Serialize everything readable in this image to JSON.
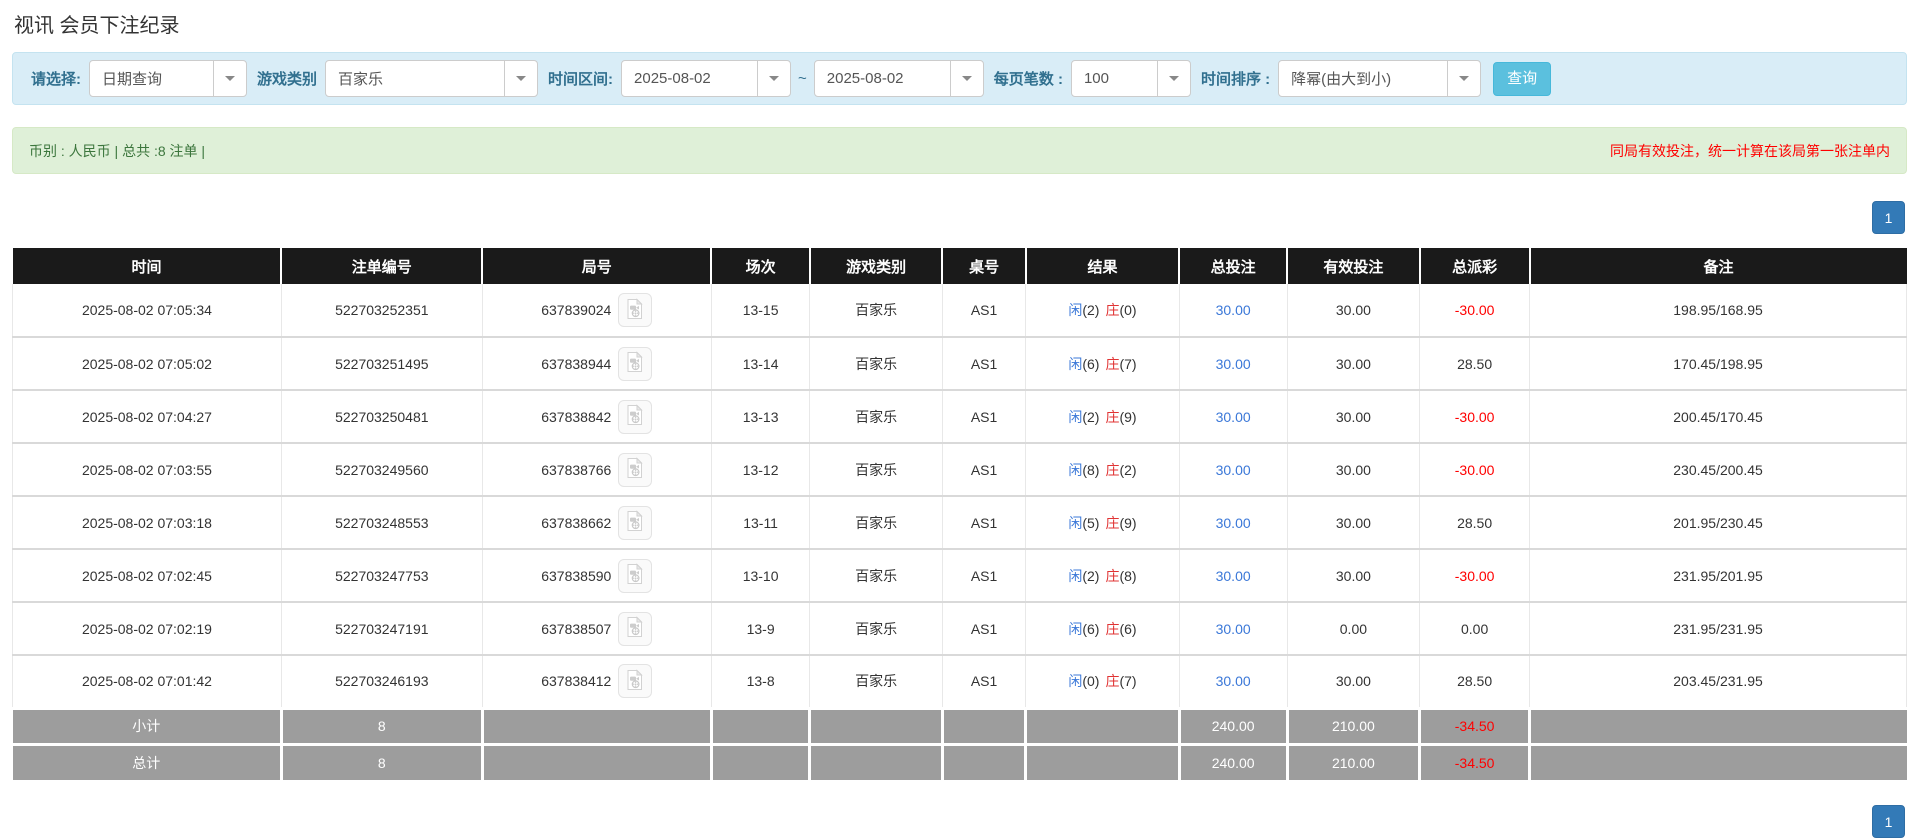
{
  "page": {
    "title": "视讯 会员下注纪录"
  },
  "toolbar": {
    "query_type": {
      "label": "请选择:",
      "value": "日期查询"
    },
    "game_category": {
      "label": "游戏类别",
      "value": "百家乐"
    },
    "time_range": {
      "label": "时间区间:",
      "from": "2025-08-02",
      "separator": "~",
      "to": "2025-08-02"
    },
    "page_size": {
      "label": "每页笔数 :",
      "value": "100"
    },
    "time_sort": {
      "label": "时间排序 :",
      "value": "降幂(由大到小)"
    },
    "search_button": "查询"
  },
  "summary_bar": {
    "left_text": "币别 : 人民币 | 总共 :8 注单 |",
    "right_note": "同局有效投注，统一计算在该局第一张注单内"
  },
  "pagination": {
    "current_page": "1"
  },
  "table": {
    "headers": [
      "时间",
      "注单编号",
      "局号",
      "场次",
      "游戏类别",
      "桌号",
      "结果",
      "总投注",
      "有效投注",
      "总派彩",
      "备注"
    ],
    "rows": [
      {
        "time": "2025-08-02 07:05:34",
        "bet_no": "522703252351",
        "round_no": "637839024",
        "session": "13-15",
        "game": "百家乐",
        "table_no": "AS1",
        "result_p": "闲",
        "result_pv": "(2)",
        "result_b": "庄",
        "result_bv": "(0)",
        "total_bet": "30.00",
        "valid_bet": "30.00",
        "payout": "-30.00",
        "remark": "198.95/168.95"
      },
      {
        "time": "2025-08-02 07:05:02",
        "bet_no": "522703251495",
        "round_no": "637838944",
        "session": "13-14",
        "game": "百家乐",
        "table_no": "AS1",
        "result_p": "闲",
        "result_pv": "(6)",
        "result_b": "庄",
        "result_bv": "(7)",
        "total_bet": "30.00",
        "valid_bet": "30.00",
        "payout": "28.50",
        "remark": "170.45/198.95"
      },
      {
        "time": "2025-08-02 07:04:27",
        "bet_no": "522703250481",
        "round_no": "637838842",
        "session": "13-13",
        "game": "百家乐",
        "table_no": "AS1",
        "result_p": "闲",
        "result_pv": "(2)",
        "result_b": "庄",
        "result_bv": "(9)",
        "total_bet": "30.00",
        "valid_bet": "30.00",
        "payout": "-30.00",
        "remark": "200.45/170.45"
      },
      {
        "time": "2025-08-02 07:03:55",
        "bet_no": "522703249560",
        "round_no": "637838766",
        "session": "13-12",
        "game": "百家乐",
        "table_no": "AS1",
        "result_p": "闲",
        "result_pv": "(8)",
        "result_b": "庄",
        "result_bv": "(2)",
        "total_bet": "30.00",
        "valid_bet": "30.00",
        "payout": "-30.00",
        "remark": "230.45/200.45"
      },
      {
        "time": "2025-08-02 07:03:18",
        "bet_no": "522703248553",
        "round_no": "637838662",
        "session": "13-11",
        "game": "百家乐",
        "table_no": "AS1",
        "result_p": "闲",
        "result_pv": "(5)",
        "result_b": "庄",
        "result_bv": "(9)",
        "total_bet": "30.00",
        "valid_bet": "30.00",
        "payout": "28.50",
        "remark": "201.95/230.45"
      },
      {
        "time": "2025-08-02 07:02:45",
        "bet_no": "522703247753",
        "round_no": "637838590",
        "session": "13-10",
        "game": "百家乐",
        "table_no": "AS1",
        "result_p": "闲",
        "result_pv": "(2)",
        "result_b": "庄",
        "result_bv": "(8)",
        "total_bet": "30.00",
        "valid_bet": "30.00",
        "payout": "-30.00",
        "remark": "231.95/201.95"
      },
      {
        "time": "2025-08-02 07:02:19",
        "bet_no": "522703247191",
        "round_no": "637838507",
        "session": "13-9",
        "game": "百家乐",
        "table_no": "AS1",
        "result_p": "闲",
        "result_pv": "(6)",
        "result_b": "庄",
        "result_bv": "(6)",
        "total_bet": "30.00",
        "valid_bet": "0.00",
        "payout": "0.00",
        "remark": "231.95/231.95"
      },
      {
        "time": "2025-08-02 07:01:42",
        "bet_no": "522703246193",
        "round_no": "637838412",
        "session": "13-8",
        "game": "百家乐",
        "table_no": "AS1",
        "result_p": "闲",
        "result_pv": "(0)",
        "result_b": "庄",
        "result_bv": "(7)",
        "total_bet": "30.00",
        "valid_bet": "30.00",
        "payout": "28.50",
        "remark": "203.45/231.95"
      }
    ],
    "subtotal": {
      "label": "小计",
      "count": "8",
      "total_bet": "240.00",
      "valid_bet": "210.00",
      "payout": "-34.50"
    },
    "grand_total": {
      "label": "总计",
      "count": "8",
      "total_bet": "240.00",
      "valid_bet": "210.00",
      "payout": "-34.50"
    }
  },
  "icons": {
    "select_caret": "chevron-down-icon",
    "round_video": "video-record-icon"
  },
  "colors": {
    "filter_bar_bg": "#d9edf7",
    "filter_label": "#31708f",
    "success_bar_bg": "#dff0d8",
    "success_text": "#3c763d",
    "note_red": "#ff0000",
    "header_bg": "#1a1a1a",
    "summary_row_bg": "#9d9d9d",
    "pagination_blue": "#337ab7",
    "search_button_bg": "#5bc0de",
    "link_blue": "#3b78d8",
    "banker_red": "#e03333"
  }
}
